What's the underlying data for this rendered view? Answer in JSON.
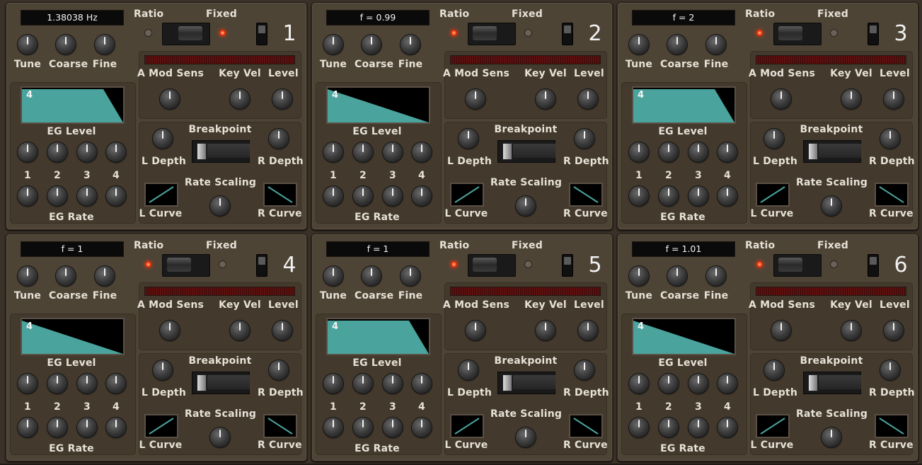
{
  "labels": {
    "ratio": "Ratio",
    "fixed": "Fixed",
    "tune": "Tune",
    "coarse": "Coarse",
    "fine": "Fine",
    "a_mod_sens": "A Mod Sens",
    "key_vel": "Key Vel",
    "level": "Level",
    "eg_level": "EG Level",
    "eg_rate": "EG Rate",
    "breakpoint": "Breakpoint",
    "l_depth": "L Depth",
    "r_depth": "R Depth",
    "rate_scaling": "Rate Scaling",
    "l_curve": "L Curve",
    "r_curve": "R Curve",
    "eg_nums": [
      "1",
      "2",
      "3",
      "4"
    ]
  },
  "colors": {
    "panel": "#4e4436",
    "subpanel": "#43392d",
    "envelope_fill": "#4aa39c",
    "led_on": "#ff3a10",
    "text": "#e6e1d6"
  },
  "operators": [
    {
      "number": "1",
      "frequency": "1.38038 Hz",
      "mode": "fixed",
      "envelope_stage": "4",
      "envelope": "sustain",
      "knobs": {
        "tune": -20,
        "coarse": -95,
        "fine": -80,
        "a_mod_sens": -140,
        "key_vel": -140,
        "level": 135,
        "eg_level": [
          135,
          -140,
          -130,
          -145
        ],
        "eg_rate": [
          20,
          140,
          140,
          0
        ],
        "l_depth": -145,
        "r_depth": -145,
        "rate_scaling": -145
      }
    },
    {
      "number": "2",
      "frequency": "f = 0.99",
      "mode": "ratio",
      "envelope_stage": "4",
      "envelope": "decay",
      "knobs": {
        "tune": 0,
        "coarse": -130,
        "fine": 135,
        "a_mod_sens": -140,
        "key_vel": -140,
        "level": -110,
        "eg_level": [
          135,
          135,
          135,
          -145
        ],
        "eg_rate": [
          135,
          140,
          140,
          -145
        ],
        "l_depth": -145,
        "r_depth": -145,
        "rate_scaling": -145
      }
    },
    {
      "number": "3",
      "frequency": "f = 2",
      "mode": "ratio",
      "envelope_stage": "4",
      "envelope": "sustain-long",
      "knobs": {
        "tune": 0,
        "coarse": -110,
        "fine": -145,
        "a_mod_sens": -140,
        "key_vel": -140,
        "level": 135,
        "eg_level": [
          135,
          135,
          135,
          -145
        ],
        "eg_rate": [
          20,
          140,
          140,
          0
        ],
        "l_depth": -145,
        "r_depth": -145,
        "rate_scaling": -145
      }
    },
    {
      "number": "4",
      "frequency": "f = 1",
      "mode": "ratio",
      "envelope_stage": "4",
      "envelope": "decay",
      "knobs": {
        "tune": 0,
        "coarse": -130,
        "fine": -145,
        "a_mod_sens": -140,
        "key_vel": -140,
        "level": -100,
        "eg_level": [
          135,
          135,
          135,
          -145
        ],
        "eg_rate": [
          135,
          140,
          140,
          -145
        ],
        "l_depth": -145,
        "r_depth": -145,
        "rate_scaling": -145
      }
    },
    {
      "number": "5",
      "frequency": "f = 1",
      "mode": "ratio",
      "envelope_stage": "4",
      "envelope": "sustain",
      "knobs": {
        "tune": 0,
        "coarse": -130,
        "fine": -145,
        "a_mod_sens": -140,
        "key_vel": -140,
        "level": 135,
        "eg_level": [
          135,
          135,
          135,
          -145
        ],
        "eg_rate": [
          20,
          140,
          140,
          0
        ],
        "l_depth": -145,
        "r_depth": -145,
        "rate_scaling": -145
      }
    },
    {
      "number": "6",
      "frequency": "f = 1.01",
      "mode": "ratio",
      "envelope_stage": "4",
      "envelope": "decay",
      "knobs": {
        "tune": 0,
        "coarse": -130,
        "fine": -145,
        "a_mod_sens": -140,
        "key_vel": -140,
        "level": -100,
        "eg_level": [
          135,
          135,
          135,
          -145
        ],
        "eg_rate": [
          135,
          140,
          140,
          -145
        ],
        "l_depth": -145,
        "r_depth": -145,
        "rate_scaling": -145
      }
    }
  ]
}
